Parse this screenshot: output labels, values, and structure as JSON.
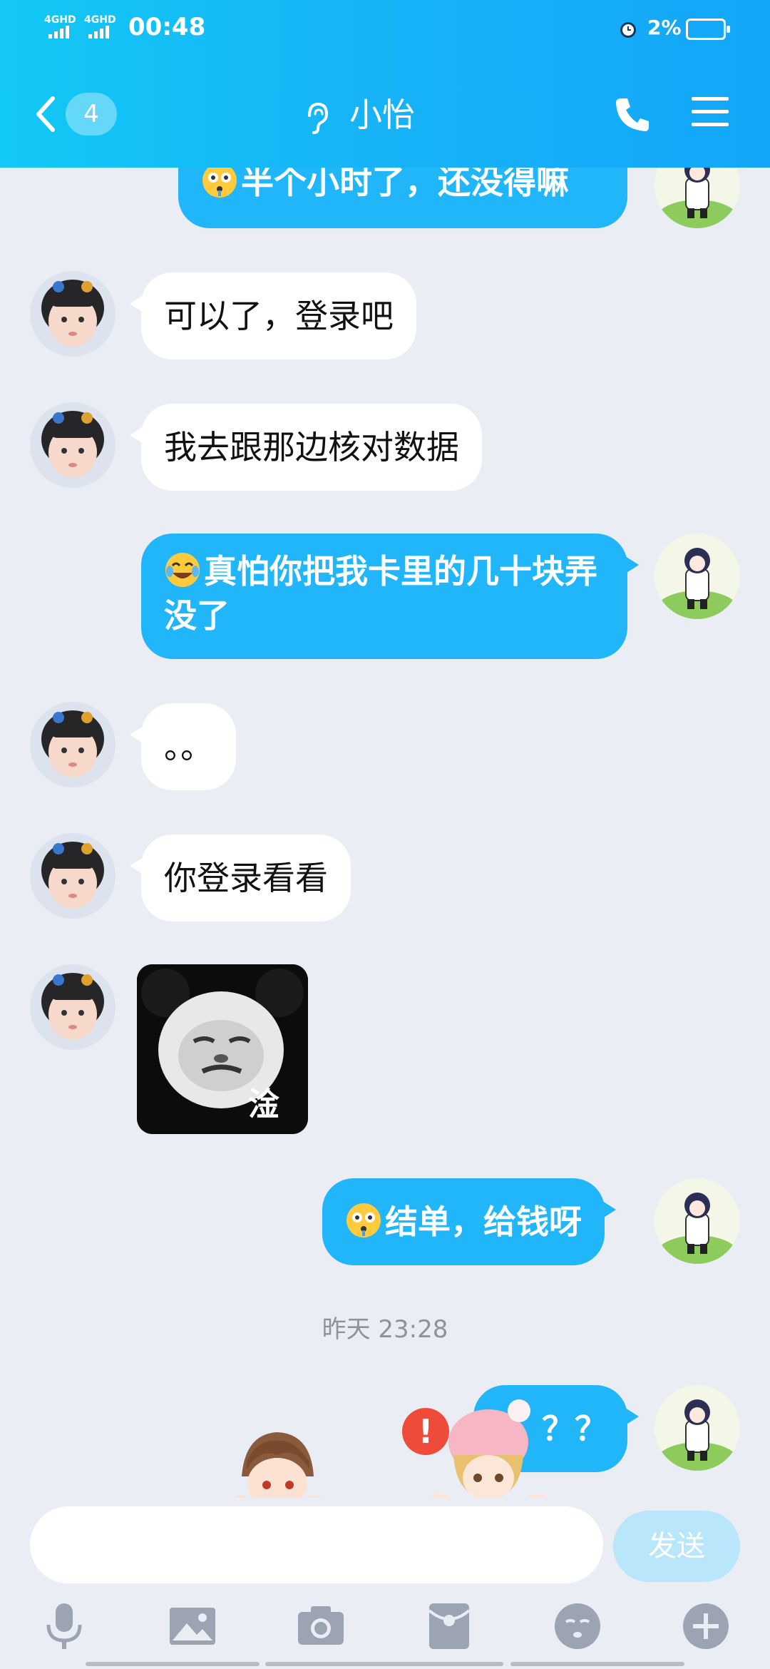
{
  "status": {
    "network_1": "4GHD",
    "network_2": "4GHD",
    "time": "00:48",
    "battery": "2%"
  },
  "header": {
    "back_count": "4",
    "title": "小怡"
  },
  "messages": [
    {
      "side": "out",
      "text": "半个小时了，还没得嘛",
      "emoji": "flushed-emoji"
    },
    {
      "side": "in",
      "text": "可以了，登录吧"
    },
    {
      "side": "in",
      "text": "我去跟那边核对数据"
    },
    {
      "side": "out",
      "text": "真怕你把我卡里的几十块弄没了",
      "emoji": "tears-of-joy-emoji"
    },
    {
      "side": "in",
      "text": "。。"
    },
    {
      "side": "in",
      "text": "你登录看看"
    },
    {
      "side": "in",
      "sticker": "panda-meme-sticker",
      "sticker_text": "淦"
    },
    {
      "side": "out",
      "text": "结单，给钱呀",
      "emoji": "flushed-emoji"
    },
    {
      "side": "out",
      "text": "？？",
      "failed": true
    }
  ],
  "timestamp": "昨天 23:28",
  "error_mark": "!",
  "input": {
    "placeholder": "",
    "send_label": "发送"
  },
  "toolbar": [
    "microphone-icon",
    "image-icon",
    "camera-icon",
    "red-packet-icon",
    "emoji-icon",
    "plus-icon"
  ],
  "colors": {
    "header_start": "#12C8F5",
    "header_end": "#13A6F8",
    "out_bubble": "#21B5F9",
    "background": "#EAEDF4",
    "send_disabled": "#B9E6FB",
    "error": "#EF4B3A"
  }
}
